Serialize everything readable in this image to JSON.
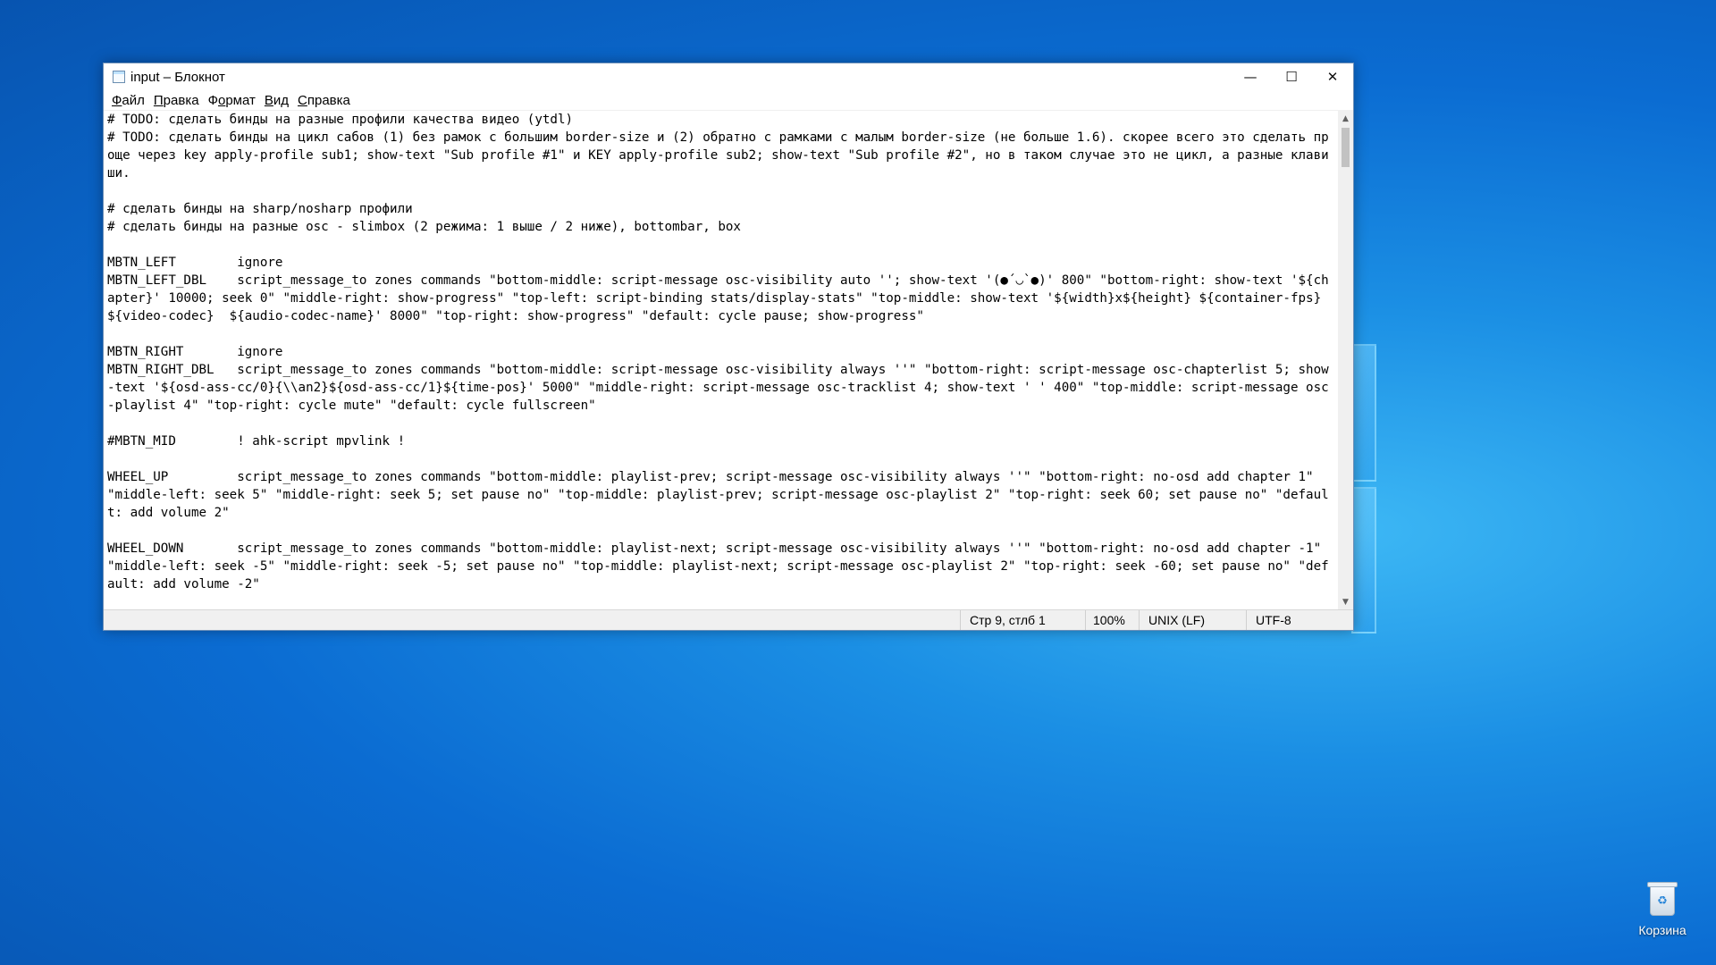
{
  "window": {
    "title": "input – Блокнот",
    "controls": {
      "minimize": "—",
      "maximize": "☐",
      "close": "✕"
    }
  },
  "menu": [
    {
      "pre": "",
      "u": "Ф",
      "post": "айл"
    },
    {
      "pre": "",
      "u": "П",
      "post": "равка"
    },
    {
      "pre": "Ф",
      "u": "о",
      "post": "рмат"
    },
    {
      "pre": "",
      "u": "В",
      "post": "ид"
    },
    {
      "pre": "",
      "u": "С",
      "post": "правка"
    }
  ],
  "editor": {
    "lines": [
      "# TODO: сделать бинды на разные профили качества видео (ytdl)",
      "# TODO: сделать бинды на цикл сабов (1) без рамок с большим border-size и (2) обратно с рамками с малым border-size (не больше 1.6). скорее всего это сделать проще через key apply-profile sub1; show-text \"Sub profile #1\" и KEY apply-profile sub2; show-text \"Sub profile #2\", но в таком случае это не цикл, а разные клавиши.",
      "",
      "# сделать бинды на sharp/nosharp профили",
      "# сделать бинды на разные osc - slimbox (2 режима: 1 выше / 2 ниже), bottombar, box",
      "",
      "MBTN_LEFT        ignore",
      "MBTN_LEFT_DBL    script_message_to zones commands \"bottom-middle: script-message osc-visibility auto ''; show-text '(●´◡`●)' 800\" \"bottom-right: show-text '${chapter}' 10000; seek 0\" \"middle-right: show-progress\" \"top-left: script-binding stats/display-stats\" \"top-middle: show-text '${width}x${height} ${container-fps}  ${video-codec}  ${audio-codec-name}' 8000\" \"top-right: show-progress\" \"default: cycle pause; show-progress\"",
      "",
      "MBTN_RIGHT       ignore",
      "MBTN_RIGHT_DBL   script_message_to zones commands \"bottom-middle: script-message osc-visibility always ''\" \"bottom-right: script-message osc-chapterlist 5; show-text '${osd-ass-cc/0}{\\\\an2}${osd-ass-cc/1}${time-pos}' 5000\" \"middle-right: script-message osc-tracklist 4; show-text ' ' 400\" \"top-middle: script-message osc-playlist 4\" \"top-right: cycle mute\" \"default: cycle fullscreen\"",
      "",
      "#MBTN_MID        ! ahk-script mpvlink !",
      "",
      "WHEEL_UP         script_message_to zones commands \"bottom-middle: playlist-prev; script-message osc-visibility always ''\" \"bottom-right: no-osd add chapter 1\" \"middle-left: seek 5\" \"middle-right: seek 5; set pause no\" \"top-middle: playlist-prev; script-message osc-playlist 2\" \"top-right: seek 60; set pause no\" \"default: add volume 2\"",
      "",
      "WHEEL_DOWN       script_message_to zones commands \"bottom-middle: playlist-next; script-message osc-visibility always ''\" \"bottom-right: no-osd add chapter -1\" \"middle-left: seek -5\" \"middle-right: seek -5; set pause no\" \"top-middle: playlist-next; script-message osc-playlist 2\" \"top-right: seek -60; set pause no\" \"default: add volume -2\""
    ]
  },
  "scrollbar": {
    "up_arrow": "▲",
    "down_arrow": "▼"
  },
  "statusbar": {
    "position": "Стр 9, стлб 1",
    "zoom": "100%",
    "line_endings": "UNIX (LF)",
    "encoding": "UTF-8"
  },
  "desktop": {
    "recycle_bin_label": "Корзина"
  }
}
